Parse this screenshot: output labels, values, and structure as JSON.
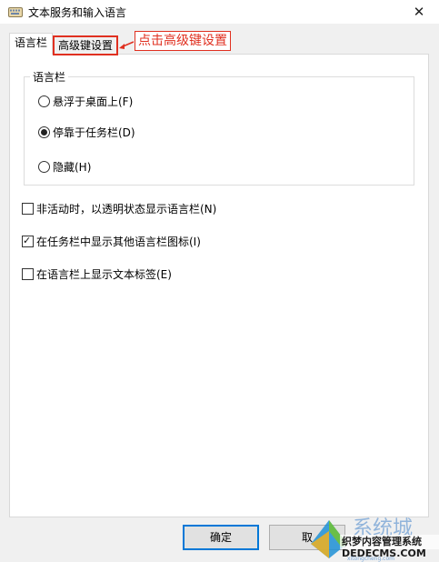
{
  "window": {
    "title": "文本服务和输入语言"
  },
  "tabs": [
    {
      "label": "语言栏"
    },
    {
      "label": "高级键设置"
    }
  ],
  "callout": {
    "text": "点击高级键设置"
  },
  "language_bar_group": {
    "label": "语言栏",
    "options": [
      {
        "label": "悬浮于桌面上(F)",
        "selected": false
      },
      {
        "label": "停靠于任务栏(D)",
        "selected": true
      },
      {
        "label": "隐藏(H)",
        "selected": false
      }
    ]
  },
  "checkboxes": [
    {
      "label": "非活动时，以透明状态显示语言栏(N)",
      "checked": false
    },
    {
      "label": "在任务栏中显示其他语言栏图标(I)",
      "checked": true
    },
    {
      "label": "在语言栏上显示文本标签(E)",
      "checked": false
    }
  ],
  "buttons": {
    "ok": "确定",
    "cancel": "取"
  },
  "watermark": {
    "line1": "系统城",
    "line2": "织梦内容管理系统",
    "line3": "DEDECMS.COM",
    "line4": "xitongcheng.com"
  },
  "colors": {
    "accent": "#0078d7",
    "callout": "#e03020"
  }
}
